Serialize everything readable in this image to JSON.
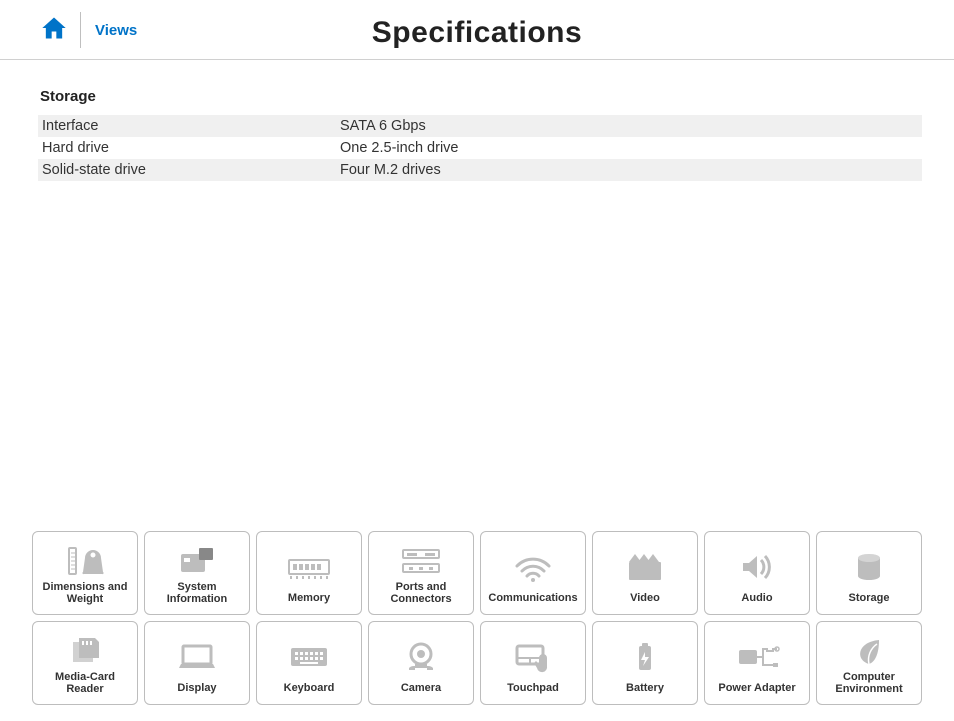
{
  "header": {
    "views_label": "Views",
    "page_title": "Specifications"
  },
  "section": {
    "title": "Storage",
    "rows": [
      {
        "label": "Interface",
        "value": "SATA 6 Gbps"
      },
      {
        "label": "Hard drive",
        "value": "One 2.5-inch drive"
      },
      {
        "label": "Solid-state drive",
        "value": "Four M.2 drives"
      }
    ]
  },
  "tiles": [
    {
      "label": "Dimensions and\nWeight",
      "icon": "dimensions-weight-icon"
    },
    {
      "label": "System\nInformation",
      "icon": "system-information-icon"
    },
    {
      "label": "Memory",
      "icon": "memory-icon"
    },
    {
      "label": "Ports and\nConnectors",
      "icon": "ports-connectors-icon"
    },
    {
      "label": "Communications",
      "icon": "communications-icon"
    },
    {
      "label": "Video",
      "icon": "video-icon"
    },
    {
      "label": "Audio",
      "icon": "audio-icon"
    },
    {
      "label": "Storage",
      "icon": "storage-icon"
    },
    {
      "label": "Media-Card\nReader",
      "icon": "media-card-reader-icon"
    },
    {
      "label": "Display",
      "icon": "display-icon"
    },
    {
      "label": "Keyboard",
      "icon": "keyboard-icon"
    },
    {
      "label": "Camera",
      "icon": "camera-icon"
    },
    {
      "label": "Touchpad",
      "icon": "touchpad-icon"
    },
    {
      "label": "Battery",
      "icon": "battery-icon"
    },
    {
      "label": "Power Adapter",
      "icon": "power-adapter-icon"
    },
    {
      "label": "Computer\nEnvironment",
      "icon": "environment-icon"
    }
  ]
}
